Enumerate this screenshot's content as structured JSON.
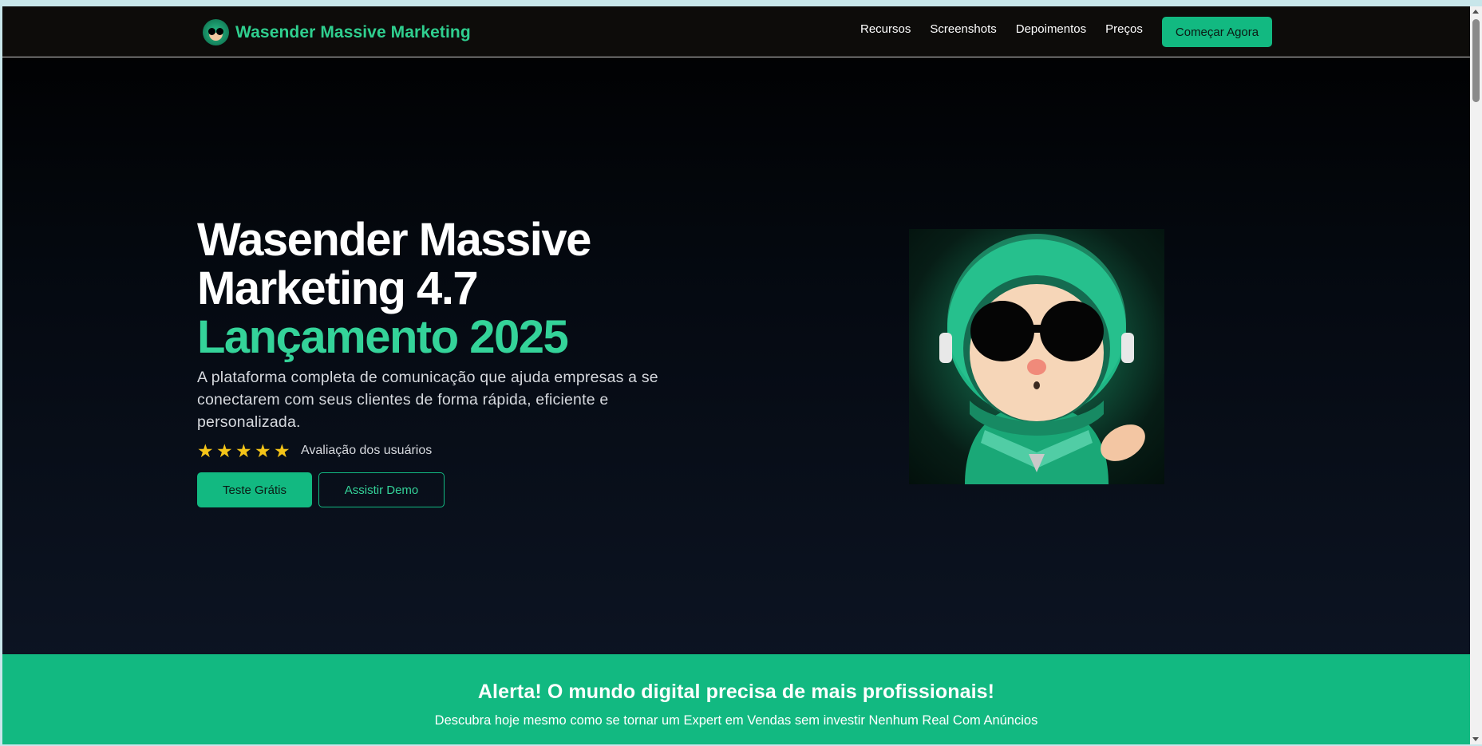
{
  "header": {
    "brand_name": "Wasender Massive Marketing",
    "logo_icon": "mascot-logo-icon",
    "nav": [
      "Recursos",
      "Screenshots",
      "Depoimentos",
      "Preços"
    ],
    "cta_label": "Começar Agora"
  },
  "hero": {
    "title_line1": "Wasender Massive",
    "title_line2": "Marketing 4.7",
    "title_accent": "Lançamento 2025",
    "subtitle": "A plataforma completa de comunicação que ajuda empresas a se conectarem com seus clientes de forma rápida, eficiente e personalizada.",
    "rating": {
      "stars": 5,
      "icon": "star-icon",
      "label": "Avaliação dos usuários"
    },
    "primary_button": "Teste Grátis",
    "secondary_button": "Assistir Demo",
    "image": "astronaut-mascot-illustration"
  },
  "alert": {
    "title": "Alerta! O mundo digital precisa de mais profissionais!",
    "text": "Descubra hoje mesmo como se tornar um Expert em Vendas sem investir Nenhum Real Com Anúncios"
  },
  "colors": {
    "accent": "#12b981",
    "accent_text": "#34d399",
    "header_bg": "#0d0c0a",
    "star": "#f5c518"
  }
}
